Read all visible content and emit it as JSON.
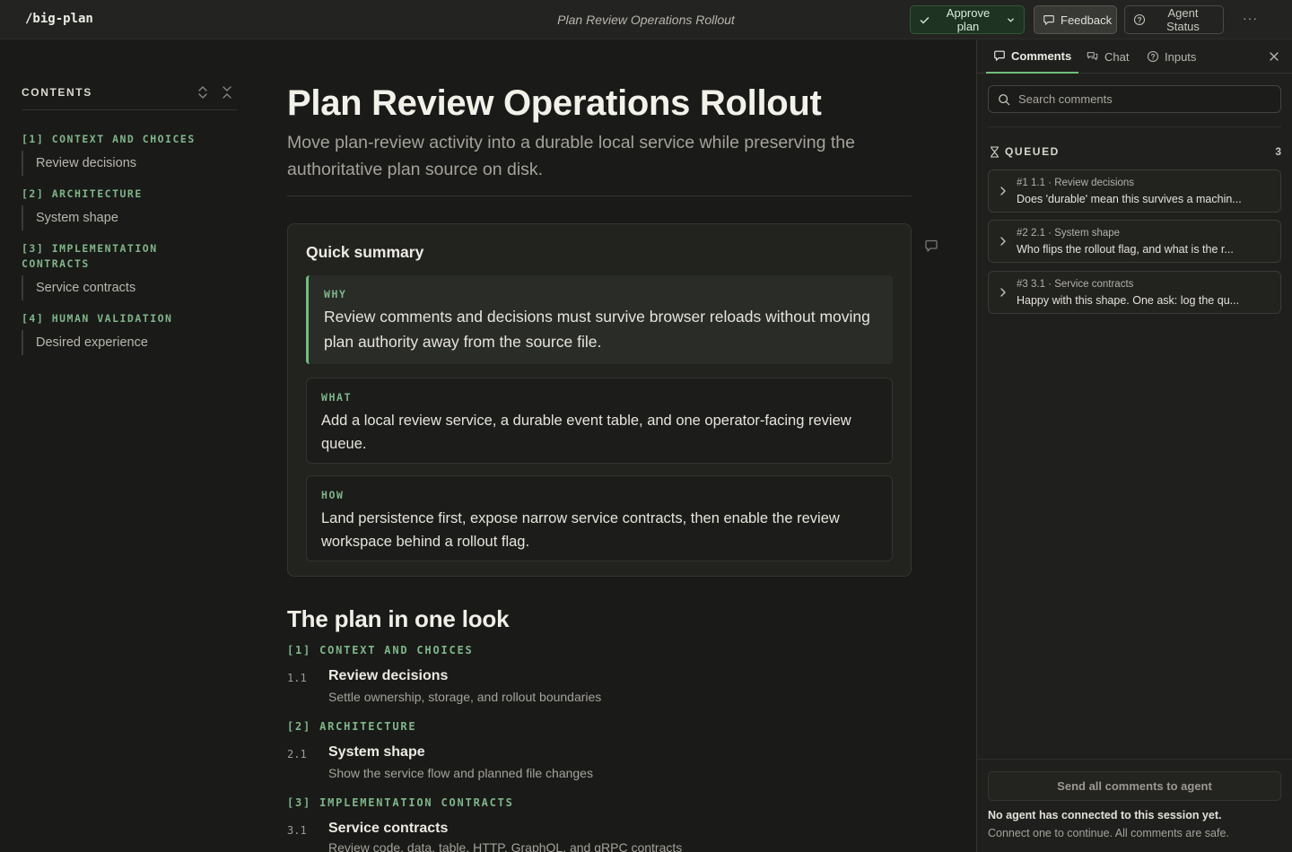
{
  "app": {
    "name": "/big-plan",
    "doc_title": "Plan Review Operations Rollout"
  },
  "toolbar": {
    "approve_label": "Approve plan",
    "feedback_label": "Feedback",
    "status_label": "Agent Status",
    "more_label": "···"
  },
  "toc": {
    "heading": "CONTENTS",
    "sections": [
      {
        "label": "[1] CONTEXT AND CHOICES",
        "item": "Review decisions"
      },
      {
        "label": "[2] ARCHITECTURE",
        "item": "System shape"
      },
      {
        "label": "[3] IMPLEMENTATION CONTRACTS",
        "item": "Service contracts"
      },
      {
        "label": "[4] HUMAN VALIDATION",
        "item": "Desired experience"
      }
    ]
  },
  "main": {
    "title": "Plan Review Operations Rollout",
    "subtitle": "Move plan-review activity into a durable local service while preserving the authoritative plan source on disk.",
    "summary": {
      "title": "Quick summary",
      "blocks": [
        {
          "label": "WHY",
          "text": "Review comments and decisions must survive browser reloads without moving plan authority away from the source file."
        },
        {
          "label": "WHAT",
          "text": "Add a local review service, a durable event table, and one operator-facing review queue."
        },
        {
          "label": "HOW",
          "text": "Land persistence first, expose narrow service contracts, then enable the review workspace behind a rollout flag."
        }
      ]
    },
    "look": {
      "title": "The plan in one look",
      "sections": [
        {
          "label": "[1] CONTEXT AND CHOICES",
          "num": "1.1",
          "title": "Review decisions",
          "desc": "Settle ownership, storage, and rollout boundaries"
        },
        {
          "label": "[2] ARCHITECTURE",
          "num": "2.1",
          "title": "System shape",
          "desc": "Show the service flow and planned file changes"
        },
        {
          "label": "[3] IMPLEMENTATION CONTRACTS",
          "num": "3.1",
          "title": "Service contracts",
          "desc": "Review code, data, table, HTTP, GraphQL, and gRPC contracts"
        }
      ]
    }
  },
  "panel": {
    "tabs": [
      {
        "label": "Comments",
        "icon": "comment-icon"
      },
      {
        "label": "Chat",
        "icon": "chat-icon"
      },
      {
        "label": "Inputs",
        "icon": "help-circle-icon"
      }
    ],
    "search_placeholder": "Search comments",
    "queued": {
      "label": "QUEUED",
      "count": "3",
      "items": [
        {
          "meta": "#1  1.1 · Review decisions",
          "text": "Does 'durable' mean this survives a machin..."
        },
        {
          "meta": "#2  2.1 · System shape",
          "text": "Who flips the rollout flag, and what is the r..."
        },
        {
          "meta": "#3  3.1 · Service contracts",
          "text": "Happy with this shape. One ask: log the qu..."
        }
      ]
    },
    "send_label": "Send all comments to agent",
    "agent_note": "No agent has connected to this session yet.",
    "agent_sub": "Connect one to continue. All comments are safe."
  },
  "colors": {
    "accent": "#6fbf7c",
    "section_label": "#7fb58a",
    "background": "#1a1a18"
  }
}
